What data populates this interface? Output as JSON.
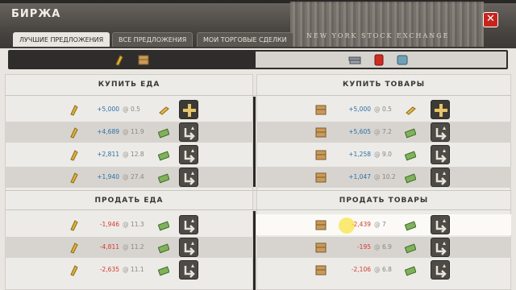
{
  "window": {
    "title": "БИРЖА",
    "close_icon": "close-icon"
  },
  "relief_text": "NEW YORK STOCK EXCHANGE",
  "tabs": [
    {
      "label": "ЛУЧШИЕ ПРЕДЛОЖЕНИЯ",
      "active": true
    },
    {
      "label": "ВСЕ ПРЕДЛОЖЕНИЯ",
      "active": false
    },
    {
      "label": "МОИ ТОРГОВЫЕ СДЕЛКИ",
      "active": false
    }
  ],
  "filters": {
    "left_icons": [
      "wheat-icon",
      "crate-icon"
    ],
    "right_icons": [
      "steel-bars-icon",
      "fuel-canister-icon",
      "water-barrel-icon"
    ]
  },
  "sections": {
    "buy_food": "КУПИТЬ ЕДА",
    "buy_goods": "КУПИТЬ ТОВАРЫ",
    "sell_food": "ПРОДАТЬ ЕДА",
    "sell_goods": "ПРОДАТЬ ТОВАРЫ"
  },
  "buy_food_rows": [
    {
      "amount": "+5,000",
      "at": "@",
      "price": "0.5",
      "currency": "gold-icon",
      "action": "add-icon"
    },
    {
      "amount": "+4,689",
      "at": "@",
      "price": "11.9",
      "currency": "cash-icon",
      "action": "trade-icon"
    },
    {
      "amount": "+2,811",
      "at": "@",
      "price": "12.8",
      "currency": "cash-icon",
      "action": "trade-icon"
    },
    {
      "amount": "+1,940",
      "at": "@",
      "price": "27.4",
      "currency": "cash-icon",
      "action": "trade-icon"
    }
  ],
  "buy_goods_rows": [
    {
      "amount": "+5,000",
      "at": "@",
      "price": "0.5",
      "currency": "gold-icon",
      "action": "add-icon"
    },
    {
      "amount": "+5,605",
      "at": "@",
      "price": "7.2",
      "currency": "cash-icon",
      "action": "trade-icon"
    },
    {
      "amount": "+1,258",
      "at": "@",
      "price": "9.0",
      "currency": "cash-icon",
      "action": "trade-icon"
    },
    {
      "amount": "+1,047",
      "at": "@",
      "price": "10.2",
      "currency": "cash-icon",
      "action": "trade-icon"
    }
  ],
  "sell_food_rows": [
    {
      "amount": "-1,946",
      "at": "@",
      "price": "11.3",
      "currency": "cash-icon",
      "action": "trade-icon"
    },
    {
      "amount": "-4,811",
      "at": "@",
      "price": "11.2",
      "currency": "cash-icon",
      "action": "trade-icon"
    },
    {
      "amount": "-2,635",
      "at": "@",
      "price": "11.1",
      "currency": "cash-icon",
      "action": "trade-icon"
    }
  ],
  "sell_goods_rows": [
    {
      "amount": "-2,439",
      "at": "@",
      "price": "7",
      "currency": "cash-icon",
      "action": "trade-icon"
    },
    {
      "amount": "-195",
      "at": "@",
      "price": "6.9",
      "currency": "cash-icon",
      "action": "trade-icon"
    },
    {
      "amount": "-2,106",
      "at": "@",
      "price": "6.8",
      "currency": "cash-icon",
      "action": "trade-icon"
    }
  ],
  "colors": {
    "buy": "#2b6fa8",
    "sell": "#d23a2e",
    "close": "#c8241e",
    "header": "#4a4642"
  }
}
